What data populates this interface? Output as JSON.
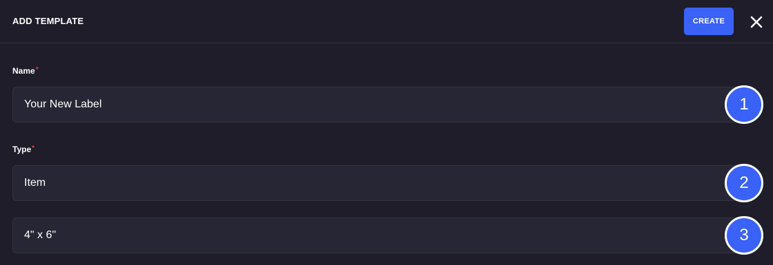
{
  "header": {
    "title": "ADD TEMPLATE",
    "create_label": "CREATE",
    "close_icon": "close-icon"
  },
  "fields": [
    {
      "label": "Name",
      "required_mark": "*",
      "value": "Your New Label",
      "badge": "1"
    },
    {
      "label": "Type",
      "required_mark": "*",
      "value": "Item",
      "badge": "2"
    },
    {
      "label": "",
      "value": "4\" x 6\"",
      "badge": "3"
    }
  ],
  "colors": {
    "background": "#1e1d29",
    "field_background": "#272634",
    "accent": "#3b62f6",
    "required": "#e0424f"
  }
}
